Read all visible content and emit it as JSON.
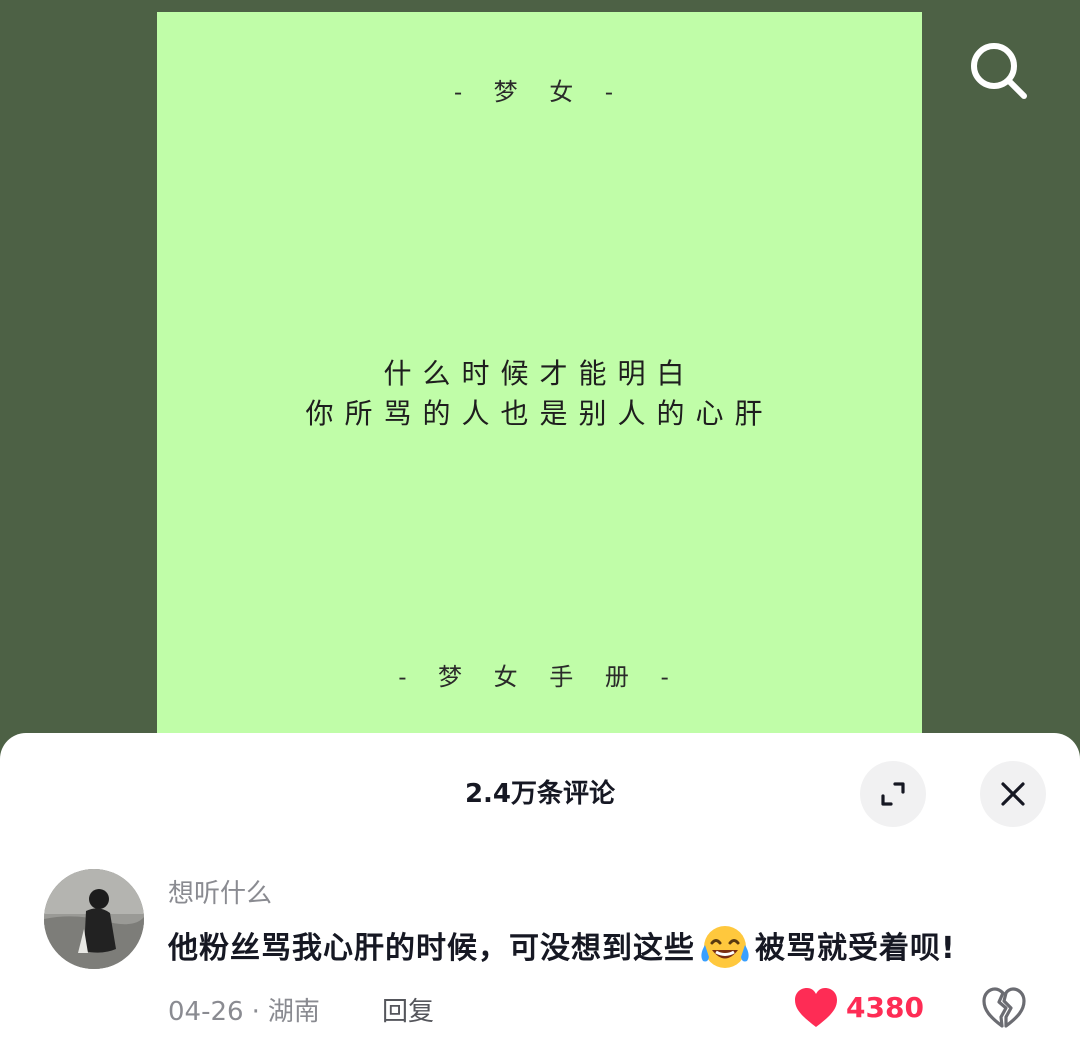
{
  "post": {
    "top_tag": "- 梦 女 -",
    "quote_lines": [
      "什么时候才能明白",
      "你所骂的人也是别人的心肝"
    ],
    "bottom_tag": "- 梦 女 手 册 -",
    "background_color": "#c0fda8"
  },
  "header": {
    "search_icon": "search-icon"
  },
  "comments_panel": {
    "title": "2.4万条评论",
    "expand_icon": "expand-icon",
    "close_icon": "close-icon"
  },
  "comment": {
    "username": "想听什么",
    "text_before_emoji": "他粉丝骂我心肝的时候，可没想到这些",
    "emoji": "laugh-cry-emoji",
    "text_after_emoji": "被骂就受着呗!",
    "date": "04-26",
    "separator": "·",
    "location": "湖南",
    "reply_label": "回复",
    "like_count": "4380",
    "like_color": "#fe2c55"
  }
}
